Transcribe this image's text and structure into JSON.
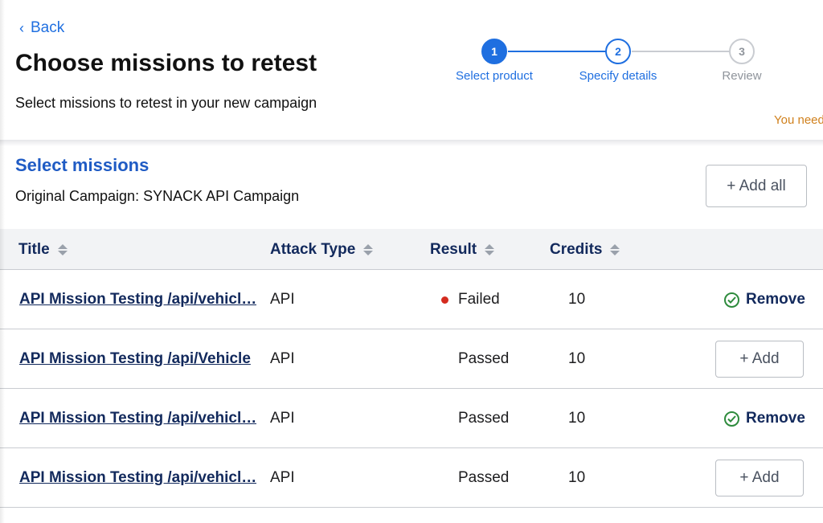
{
  "header": {
    "back_label": "Back",
    "title": "Choose missions to retest",
    "subtitle": "Select missions to retest in your new campaign",
    "warning_text": "You need"
  },
  "stepper": {
    "steps": [
      {
        "number": "1",
        "label": "Select product",
        "state": "done"
      },
      {
        "number": "2",
        "label": "Specify details",
        "state": "active"
      },
      {
        "number": "3",
        "label": "Review",
        "state": "pending"
      }
    ]
  },
  "section": {
    "title": "Select missions",
    "subtitle": "Original Campaign: SYNACK API Campaign",
    "add_all_label": "+ Add all"
  },
  "table": {
    "columns": [
      "Title",
      "Attack Type",
      "Result",
      "Credits"
    ],
    "rows": [
      {
        "title": "API Mission Testing /api/vehicle/{vehicleId}/location",
        "title_display": "API Mission Testing /api/vehicl…",
        "attack_type": "API",
        "result": "Failed",
        "result_marker": "red-dot",
        "credits": "10",
        "action": "Remove"
      },
      {
        "title": "API Mission Testing /api/Vehicle",
        "title_display": "API Mission Testing /api/Vehicle",
        "attack_type": "API",
        "result": "Passed",
        "result_marker": "",
        "credits": "10",
        "action": "+ Add"
      },
      {
        "title": "API Mission Testing /api/vehicle/{vehicleId}",
        "title_display": "API Mission Testing /api/vehicl…",
        "attack_type": "API",
        "result": "Passed",
        "result_marker": "",
        "credits": "10",
        "action": "Remove"
      },
      {
        "title": "API Mission Testing /api/vehicle/{vehicleId}/status",
        "title_display": "API Mission Testing /api/vehicl…",
        "attack_type": "API",
        "result": "Passed",
        "result_marker": "",
        "credits": "10",
        "action": "+ Add"
      }
    ]
  },
  "colors": {
    "primary_blue": "#1f6fe0",
    "navy_text": "#12295c",
    "failed_red": "#d42b1f",
    "success_green": "#2e8b3d",
    "warning_orange": "#d0801c"
  }
}
